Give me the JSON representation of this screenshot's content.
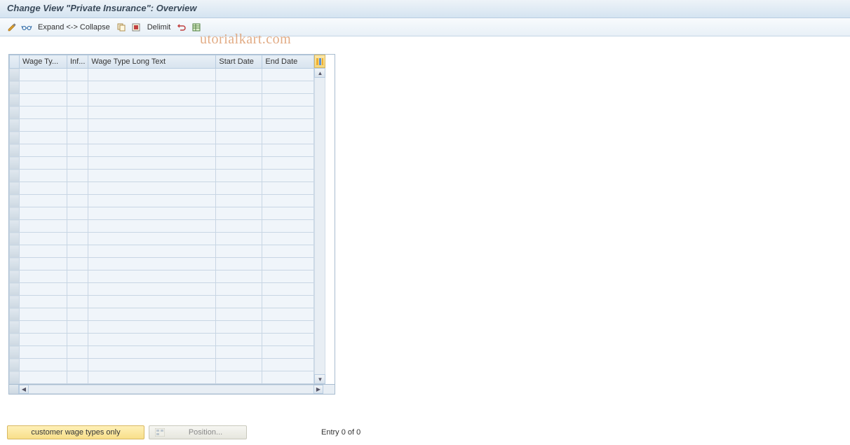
{
  "title": "Change View \"Private Insurance\": Overview",
  "toolbar": {
    "expand_collapse": "Expand <-> Collapse",
    "delimit": "Delimit"
  },
  "watermark": "utorialkart.com",
  "table": {
    "columns": [
      "Wage Ty...",
      "Inf...",
      "Wage Type Long Text",
      "Start Date",
      "End Date"
    ],
    "row_count": 25
  },
  "footer": {
    "customer_btn": "customer wage types only",
    "position_btn": "Position...",
    "status": "Entry 0 of 0"
  }
}
